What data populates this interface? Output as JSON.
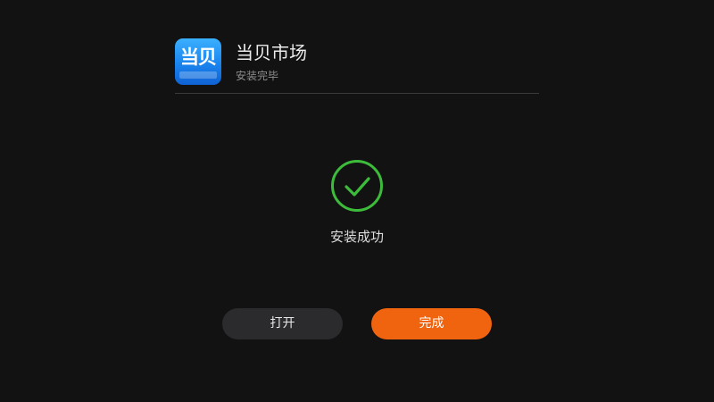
{
  "app": {
    "name": "当贝市场",
    "status": "安装完毕",
    "icon_glyph": "当贝",
    "icon_name": "dangbei-market-app-icon"
  },
  "result": {
    "icon_name": "check-circle-icon",
    "message": "安装成功"
  },
  "buttons": {
    "open_label": "打开",
    "done_label": "完成"
  },
  "colors": {
    "background": "#121213",
    "success_green": "#3dbb3a",
    "primary_orange": "#f06410",
    "secondary_button": "#2b2b2d",
    "icon_blue": "#1a84ee"
  }
}
